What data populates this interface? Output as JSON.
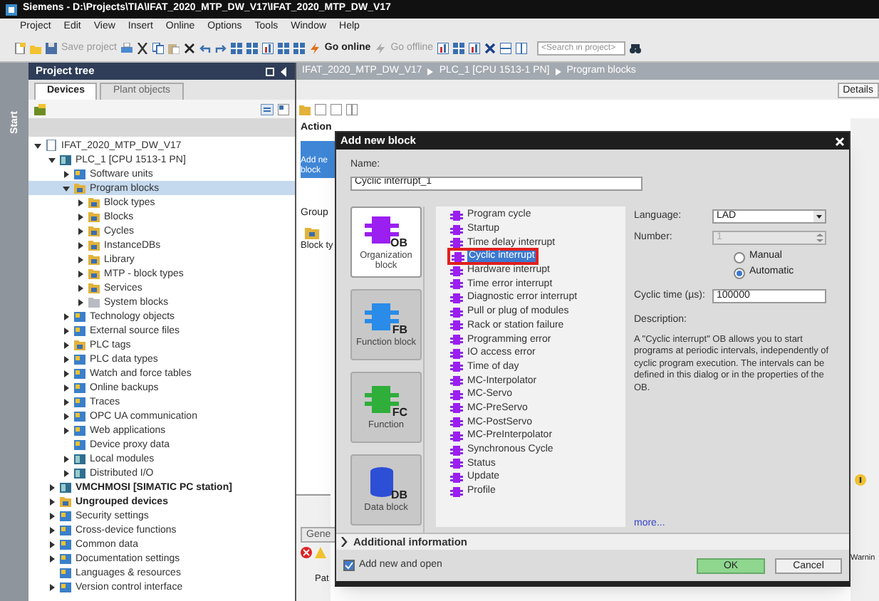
{
  "window": {
    "title": "Siemens - D:\\Projects\\TIA\\IFAT_2020_MTP_DW_V17\\IFAT_2020_MTP_DW_V17"
  },
  "menu": [
    "Project",
    "Edit",
    "View",
    "Insert",
    "Online",
    "Options",
    "Tools",
    "Window",
    "Help"
  ],
  "toolbar": {
    "save_project": {
      "label": "Save project",
      "disabled": true
    },
    "go_online": {
      "label": "Go online",
      "disabled": false
    },
    "go_offline": {
      "label": "Go offline",
      "disabled": true
    },
    "search_placeholder": "<Search in project>"
  },
  "start_strip": "Start",
  "project_tree": {
    "title": "Project tree",
    "tabs": [
      {
        "label": "Devices",
        "selected": true
      },
      {
        "label": "Plant objects",
        "selected": false
      }
    ],
    "items": [
      {
        "label": "IFAT_2020_MTP_DW_V17",
        "kind": "project",
        "expanded": true,
        "selected": false,
        "children": [
          {
            "label": "PLC_1 [CPU 1513-1 PN]",
            "kind": "device",
            "expanded": true,
            "selected": false,
            "children": [
              {
                "label": "Software units",
                "kind": "panel",
                "expanded": false,
                "selected": false
              },
              {
                "label": "Program blocks",
                "kind": "folder",
                "expanded": true,
                "selected": true,
                "children": [
                  {
                    "label": "Block types",
                    "kind": "folder",
                    "expanded": false,
                    "selected": false
                  },
                  {
                    "label": "Blocks",
                    "kind": "folder",
                    "expanded": false,
                    "selected": false
                  },
                  {
                    "label": "Cycles",
                    "kind": "folder",
                    "expanded": false,
                    "selected": false
                  },
                  {
                    "label": "InstanceDBs",
                    "kind": "folder",
                    "expanded": false,
                    "selected": false
                  },
                  {
                    "label": "Library",
                    "kind": "folder",
                    "expanded": false,
                    "selected": false
                  },
                  {
                    "label": "MTP - block types",
                    "kind": "folder",
                    "expanded": false,
                    "selected": false
                  },
                  {
                    "label": "Services",
                    "kind": "folder",
                    "expanded": false,
                    "selected": false
                  },
                  {
                    "label": "System blocks",
                    "kind": "grayfolder",
                    "expanded": false,
                    "selected": false
                  }
                ]
              },
              {
                "label": "Technology objects",
                "kind": "panel",
                "expanded": false,
                "selected": false
              },
              {
                "label": "External source files",
                "kind": "panel",
                "expanded": false,
                "selected": false
              },
              {
                "label": "PLC tags",
                "kind": "folder",
                "expanded": false,
                "selected": false
              },
              {
                "label": "PLC data types",
                "kind": "panel",
                "expanded": false,
                "selected": false
              },
              {
                "label": "Watch and force tables",
                "kind": "panel",
                "expanded": false,
                "selected": false
              },
              {
                "label": "Online backups",
                "kind": "panel",
                "expanded": false,
                "selected": false
              },
              {
                "label": "Traces",
                "kind": "panel",
                "expanded": false,
                "selected": false
              },
              {
                "label": "OPC UA communication",
                "kind": "panel",
                "expanded": false,
                "selected": false
              },
              {
                "label": "Web applications",
                "kind": "panel",
                "expanded": false,
                "selected": false
              },
              {
                "label": "Device proxy data",
                "kind": "panel",
                "selected": false
              },
              {
                "label": "Local modules",
                "kind": "device",
                "expanded": false,
                "selected": false
              },
              {
                "label": "Distributed I/O",
                "kind": "device",
                "expanded": false,
                "selected": false
              }
            ]
          },
          {
            "label": "VMCHMOSI [SIMATIC PC station]",
            "kind": "device",
            "bold": true,
            "expanded": false,
            "selected": false
          },
          {
            "label": "Ungrouped devices",
            "kind": "folder",
            "bold": true,
            "expanded": false,
            "selected": false
          },
          {
            "label": "Security settings",
            "kind": "panel",
            "expanded": false,
            "selected": false
          },
          {
            "label": "Cross-device functions",
            "kind": "panel",
            "expanded": false,
            "selected": false
          },
          {
            "label": "Common data",
            "kind": "panel",
            "expanded": false,
            "selected": false
          },
          {
            "label": "Documentation settings",
            "kind": "panel",
            "expanded": false,
            "selected": false
          },
          {
            "label": "Languages & resources",
            "kind": "panel",
            "selected": false
          },
          {
            "label": "Version control interface",
            "kind": "panel",
            "expanded": false,
            "selected": false
          }
        ]
      }
    ]
  },
  "breadcrumb": [
    "IFAT_2020_MTP_DW_V17",
    "PLC_1 [CPU 1513-1 PN]",
    "Program blocks"
  ],
  "editor": {
    "details_button": "Details",
    "actions_label": "Action",
    "add_block_button": "Add ne block",
    "group_label": "Group",
    "block_types_label": "Block ty",
    "inspector_tab": "Gene",
    "column_label": "Pat",
    "warnings_label": "Warnin"
  },
  "dialog": {
    "title": "Add new block",
    "name_label": "Name:",
    "name_value": "Cyclic interrupt_1",
    "block_types": [
      {
        "kind": "ob",
        "icon_text": "OB",
        "label": "Organization block",
        "selected": true
      },
      {
        "kind": "fb",
        "icon_text": "FB",
        "label": "Function block",
        "selected": false
      },
      {
        "kind": "fc",
        "icon_text": "FC",
        "label": "Function",
        "selected": false
      },
      {
        "kind": "db",
        "icon_text": "DB",
        "label": "Data block",
        "selected": false
      }
    ],
    "ob_types": [
      {
        "label": "Program cycle",
        "selected": false,
        "annotated": false
      },
      {
        "label": "Startup",
        "selected": false,
        "annotated": false
      },
      {
        "label": "Time delay interrupt",
        "selected": false,
        "annotated": false
      },
      {
        "label": "Cyclic interrupt",
        "selected": true,
        "annotated": true
      },
      {
        "label": "Hardware interrupt",
        "selected": false,
        "annotated": false
      },
      {
        "label": "Time error interrupt",
        "selected": false,
        "annotated": false
      },
      {
        "label": "Diagnostic error interrupt",
        "selected": false,
        "annotated": false
      },
      {
        "label": "Pull or plug of modules",
        "selected": false,
        "annotated": false
      },
      {
        "label": "Rack or station failure",
        "selected": false,
        "annotated": false
      },
      {
        "label": "Programming error",
        "selected": false,
        "annotated": false
      },
      {
        "label": "IO access error",
        "selected": false,
        "annotated": false
      },
      {
        "label": "Time of day",
        "selected": false,
        "annotated": false
      },
      {
        "label": "MC-Interpolator",
        "selected": false,
        "annotated": false
      },
      {
        "label": "MC-Servo",
        "selected": false,
        "annotated": false
      },
      {
        "label": "MC-PreServo",
        "selected": false,
        "annotated": false
      },
      {
        "label": "MC-PostServo",
        "selected": false,
        "annotated": false
      },
      {
        "label": "MC-PreInterpolator",
        "selected": false,
        "annotated": false
      },
      {
        "label": "Synchronous Cycle",
        "selected": false,
        "annotated": false
      },
      {
        "label": "Status",
        "selected": false,
        "annotated": false
      },
      {
        "label": "Update",
        "selected": false,
        "annotated": false
      },
      {
        "label": "Profile",
        "selected": false,
        "annotated": false
      }
    ],
    "language_label": "Language:",
    "language_value": "LAD",
    "number_label": "Number:",
    "number_value": "1",
    "number_disabled": true,
    "numbering": [
      {
        "label": "Manual",
        "selected": false
      },
      {
        "label": "Automatic",
        "selected": true
      }
    ],
    "cycle_label": "Cyclic time (µs):",
    "cycle_value": "100000",
    "description_label": "Description:",
    "description": "A \"Cyclic interrupt\" OB allows you to start programs at periodic intervals, independently of cyclic program execution. The intervals can be defined in this dialog or in the properties of the OB.",
    "more_link": "more...",
    "additional_info": {
      "label": "Additional information",
      "expanded": false
    },
    "add_and_open": {
      "label": "Add new and open",
      "checked": true
    },
    "ok_button": "OK",
    "cancel_button": "Cancel"
  }
}
